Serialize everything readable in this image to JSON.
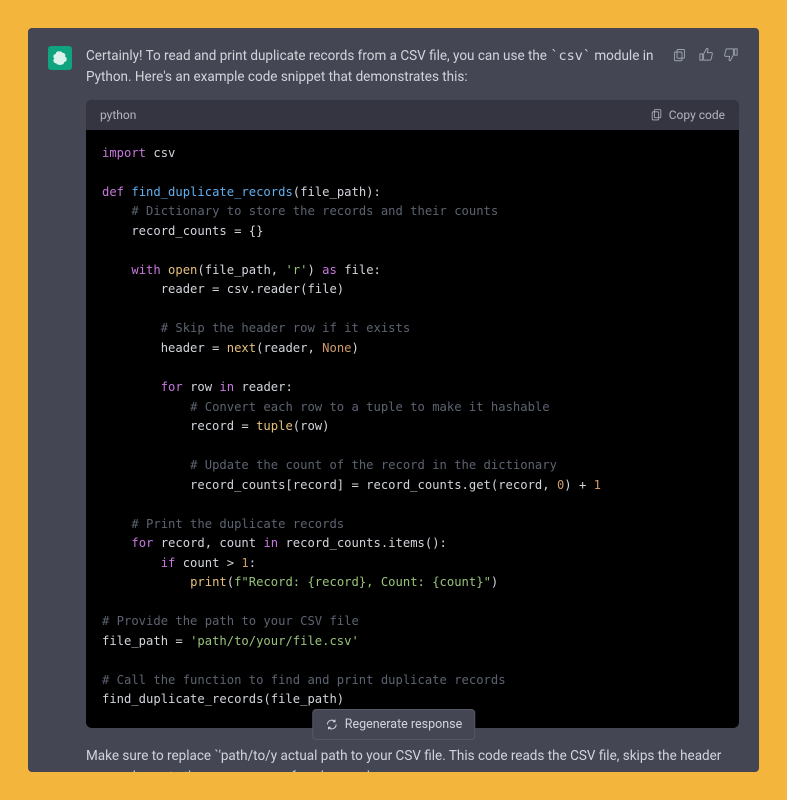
{
  "message": {
    "intro_text_part1": "Certainly! To read and print duplicate records from a CSV file, you can use the ",
    "intro_inline_code": "`csv`",
    "intro_text_part2": " module in Python. Here's an example code snippet that demonstrates this:"
  },
  "code_block": {
    "language_label": "python",
    "copy_label": "Copy code",
    "lines": [
      [
        {
          "t": "import ",
          "c": "kw-import"
        },
        {
          "t": "csv",
          "c": ""
        }
      ],
      [],
      [
        {
          "t": "def ",
          "c": "kw-def"
        },
        {
          "t": "find_duplicate_records",
          "c": "fn-name"
        },
        {
          "t": "(file_path):",
          "c": ""
        }
      ],
      [
        {
          "t": "    "
        },
        {
          "t": "# Dictionary to store the records and their counts",
          "c": "cmt"
        }
      ],
      [
        {
          "t": "    record_counts = {}",
          "c": ""
        }
      ],
      [],
      [
        {
          "t": "    "
        },
        {
          "t": "with ",
          "c": "kw-with"
        },
        {
          "t": "open",
          "c": "builtin2"
        },
        {
          "t": "(file_path, ",
          "c": ""
        },
        {
          "t": "'r'",
          "c": "str"
        },
        {
          "t": ") ",
          "c": ""
        },
        {
          "t": "as",
          "c": "kw-as"
        },
        {
          "t": " file:",
          "c": ""
        }
      ],
      [
        {
          "t": "        reader = csv.reader(file)",
          "c": ""
        }
      ],
      [],
      [
        {
          "t": "        "
        },
        {
          "t": "# Skip the header row if it exists",
          "c": "cmt"
        }
      ],
      [
        {
          "t": "        header = ",
          "c": ""
        },
        {
          "t": "next",
          "c": "builtin2"
        },
        {
          "t": "(reader, ",
          "c": ""
        },
        {
          "t": "None",
          "c": "kw-none"
        },
        {
          "t": ")",
          "c": ""
        }
      ],
      [],
      [
        {
          "t": "        "
        },
        {
          "t": "for ",
          "c": "kw-for"
        },
        {
          "t": "row ",
          "c": ""
        },
        {
          "t": "in ",
          "c": "kw-in"
        },
        {
          "t": "reader:",
          "c": ""
        }
      ],
      [
        {
          "t": "            "
        },
        {
          "t": "# Convert each row to a tuple to make it hashable",
          "c": "cmt"
        }
      ],
      [
        {
          "t": "            record = ",
          "c": ""
        },
        {
          "t": "tuple",
          "c": "builtin2"
        },
        {
          "t": "(row)",
          "c": ""
        }
      ],
      [],
      [
        {
          "t": "            "
        },
        {
          "t": "# Update the count of the record in the dictionary",
          "c": "cmt"
        }
      ],
      [
        {
          "t": "            record_counts[record] = record_counts.get(record, ",
          "c": ""
        },
        {
          "t": "0",
          "c": "num"
        },
        {
          "t": ") + ",
          "c": ""
        },
        {
          "t": "1",
          "c": "num"
        }
      ],
      [],
      [
        {
          "t": "    "
        },
        {
          "t": "# Print the duplicate records",
          "c": "cmt"
        }
      ],
      [
        {
          "t": "    "
        },
        {
          "t": "for ",
          "c": "kw-for"
        },
        {
          "t": "record, count ",
          "c": ""
        },
        {
          "t": "in ",
          "c": "kw-in"
        },
        {
          "t": "record_counts.items():",
          "c": ""
        }
      ],
      [
        {
          "t": "        "
        },
        {
          "t": "if ",
          "c": "kw-if"
        },
        {
          "t": "count > ",
          "c": ""
        },
        {
          "t": "1",
          "c": "num"
        },
        {
          "t": ":",
          "c": ""
        }
      ],
      [
        {
          "t": "            "
        },
        {
          "t": "print",
          "c": "builtin2"
        },
        {
          "t": "(",
          "c": ""
        },
        {
          "t": "f\"Record: {record}, Count: {count}\"",
          "c": "fstr"
        },
        {
          "t": ")",
          "c": ""
        }
      ],
      [],
      [
        {
          "t": "# Provide the path to your CSV file",
          "c": "cmt"
        }
      ],
      [
        {
          "t": "file_path = ",
          "c": ""
        },
        {
          "t": "'path/to/your/file.csv'",
          "c": "str"
        }
      ],
      [],
      [
        {
          "t": "# Call the function to find and print duplicate records",
          "c": "cmt"
        }
      ],
      [
        {
          "t": "find_duplicate_records(file_path)",
          "c": ""
        }
      ]
    ]
  },
  "after_message": {
    "part1": "Make sure to replace ",
    "inline": "`'path/to/y",
    "part2": "                                    actual path to your CSV file. This code reads the CSV file, skips the header row, and counts the occurrences of each record."
  },
  "regenerate_label": "Regenerate response"
}
